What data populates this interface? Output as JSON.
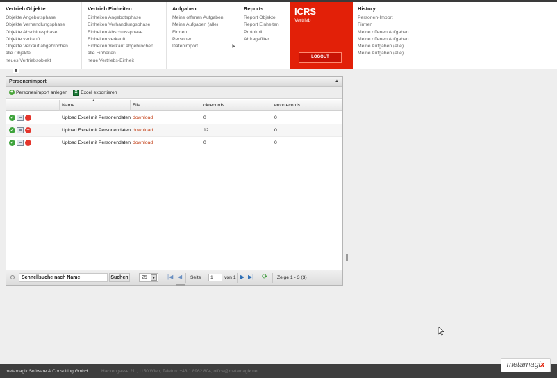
{
  "menu": {
    "col1": {
      "title": "Vertrieb Objekte",
      "items": [
        "Objekte Angebotsphase",
        "Objekte Verhandlungsphase",
        "Objekte Abschlussphase",
        "Objekte verkauft",
        "Objekte Verkauf abgebrochen",
        "alle Objekte",
        "neues Vertriebsobjekt"
      ]
    },
    "col2": {
      "title": "Vertrieb Einheiten",
      "items": [
        "Einheiten Angebotsphase",
        "Einheiten Verhandlungsphase",
        "Einheiten Abschlussphase",
        "Einheiten verkauft",
        "Einheiten Verkauf abgebrochen",
        "alle Einheiten",
        "neue Vertriebs-Einheit"
      ]
    },
    "col3": {
      "title": "Aufgaben",
      "items": [
        "Meine offenen Aufgaben",
        "Meine Aufgaben (alle)",
        "Firmen",
        "Personen",
        "Datenimport"
      ]
    },
    "col4": {
      "title": "Reports",
      "items": [
        "Report Objekte",
        "Report Einheiten",
        "Protokoll",
        "Abfragefilter"
      ]
    },
    "col5": {
      "title": "History",
      "items": [
        "Personen-Import",
        "Firmen",
        "Meine offenen Aufgaben",
        "Meine offenen Aufgaben",
        "Meine Aufgaben (alle)",
        "Meine Aufgaben (alle)"
      ]
    }
  },
  "brand": {
    "title": "ICRS",
    "subtitle": "Vertrieb",
    "logout": "LOGOUT"
  },
  "panel": {
    "title": "Personenimport",
    "toolbar": {
      "add": "Personenimport anlegen",
      "export": "Excel exportieren"
    },
    "columns": [
      "Name",
      "File",
      "okrecords",
      "errorrecords"
    ],
    "rows": [
      {
        "name": "Upload Excel mit Personendaten",
        "file": "download",
        "ok": "0",
        "err": "0"
      },
      {
        "name": "Upload Excel mit Personendaten",
        "file": "download",
        "ok": "12",
        "err": "0"
      },
      {
        "name": "Upload Excel mit Personendaten",
        "file": "download",
        "ok": "0",
        "err": "0"
      }
    ],
    "pager": {
      "search_value": "Schnellsuche nach Name",
      "search_btn": "Suchen",
      "page_size": "25",
      "page_label": "Seite",
      "page": "1",
      "of_label": "von 1",
      "summary": "Zeige 1 - 3 (3)"
    }
  },
  "footer": {
    "company": "metamagix Software & Consulting GmbH",
    "address": "Hackengasse 21 , 1150 Wien, Telefon: +43 1 8962 804, office@metamagix.net",
    "logo_main": "metamagi",
    "logo_accent": "x"
  }
}
